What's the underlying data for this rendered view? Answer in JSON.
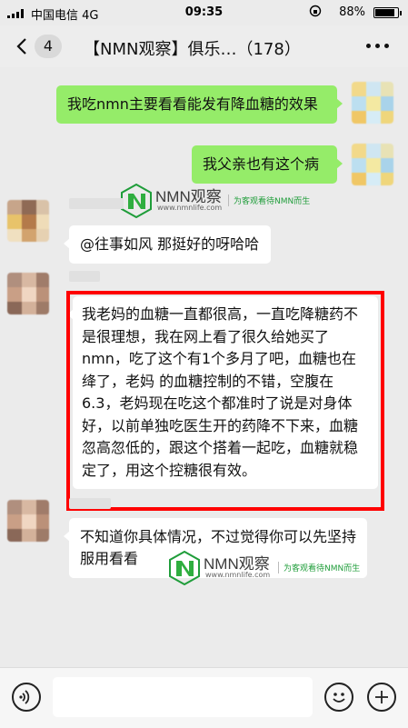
{
  "status_bar": {
    "carrier": "中国电信",
    "network": "4G",
    "time": "09:35",
    "battery_pct": "88%",
    "battery_level": 0.88
  },
  "nav": {
    "back_icon": "chevron-left-icon",
    "unread_count": "4",
    "title": "【NMN观察】俱乐…（178）",
    "more_icon": "more-dots-icon"
  },
  "messages": [
    {
      "side": "right",
      "text": "我吃nmn主要看看能发有降血糖的效果"
    },
    {
      "side": "right",
      "text": "我父亲也有这个病"
    },
    {
      "side": "left",
      "text": "@往事如风 那挺好的呀哈哈"
    },
    {
      "side": "left",
      "text": "我老妈的血糖一直都很高，一直吃降糖药不是很理想，我在网上看了很久给她买了nmn，吃了这个有1个多月了吧，血糖也在绛了，老妈 的血糖控制的不错，空腹在6.3，老妈现在吃这个都准时了说是对身体好，以前单独吃医生开的药降不下来，血糖忽高忽低的，跟这个搭着一起吃，血糖就稳定了，用这个控糖很有效。"
    },
    {
      "side": "left",
      "text": "不知道你具体情况，不过觉得你可以先坚持服用看看"
    }
  ],
  "watermark": {
    "name": "NMN观察",
    "url": "www.nmnlife.com",
    "slogan": "为客观看待NMN而生"
  },
  "input_bar": {
    "voice_icon": "voice-icon",
    "emoji_icon": "emoji-icon",
    "plus_icon": "plus-icon"
  },
  "colors": {
    "accent_bubble": "#95ec69",
    "highlight_border": "#ff0000",
    "watermark_green": "#1f9d3a"
  }
}
